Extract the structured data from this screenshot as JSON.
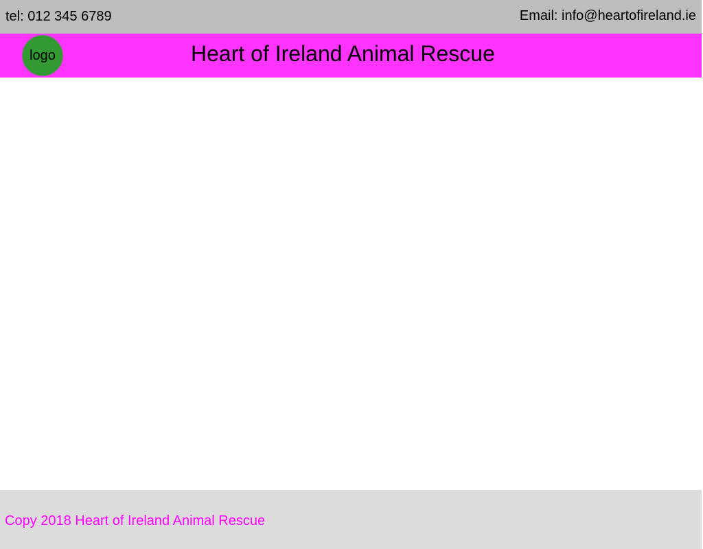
{
  "topbar": {
    "tel": "tel: 012 345 6789",
    "email": "Email: info@heartofireland.ie"
  },
  "header": {
    "logo_text": "logo",
    "title": "Heart of Ireland Animal Rescue"
  },
  "footer": {
    "copyright": "Copy 2018 Heart of Ireland Animal Rescue"
  },
  "colors": {
    "topbar_bg": "#bdbdbd",
    "header_bg": "#ff33ff",
    "logo_bg": "#339933",
    "footer_bg": "#dcdcdc",
    "footer_text": "#ff00ff"
  }
}
